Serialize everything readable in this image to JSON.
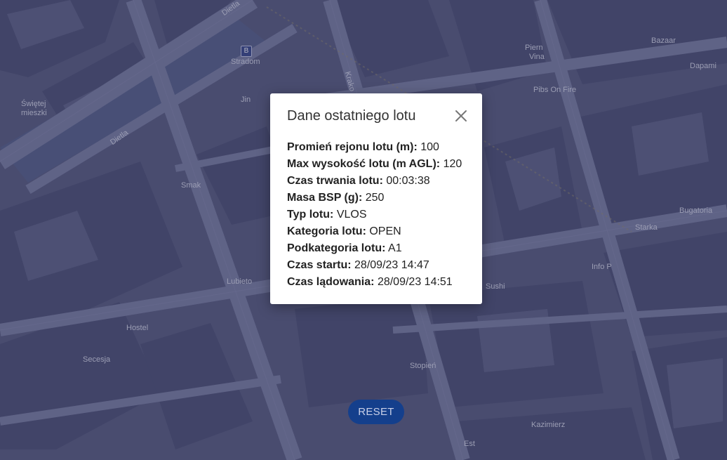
{
  "map": {
    "labels": {
      "dietla1": "Dietla",
      "dietla2": "Dietla",
      "stradom": "Stradom",
      "swietej": "Świętej",
      "mieszki": "mieszki",
      "jin": "Jin",
      "krako": "Krako",
      "smak": "Smak",
      "lubieto": "Lubieto",
      "hostel": "Hostel",
      "secesja": "Secesja",
      "piern": "Piern",
      "vina": "Vina",
      "pibs": "Pibs On Fire",
      "bazaar": "Bazaar",
      "dapami": "Dapami",
      "starka": "Starka",
      "info": "Info P",
      "sushi": "Sushi",
      "galatoria": "Bugatoria",
      "stopien": "Stopień",
      "kazimierz": "Kazimierz",
      "est": "Est"
    },
    "metro_glyph": "B"
  },
  "modal": {
    "title": "Dane ostatniego lotu",
    "close_icon": "close-icon",
    "rows": [
      {
        "label": "Promień rejonu lotu (m):",
        "value": "100"
      },
      {
        "label": "Max wysokość lotu (m AGL):",
        "value": "120"
      },
      {
        "label": "Czas trwania lotu:",
        "value": "00:03:38"
      },
      {
        "label": "Masa BSP (g):",
        "value": "250"
      },
      {
        "label": "Typ lotu:",
        "value": "VLOS"
      },
      {
        "label": "Kategoria lotu:",
        "value": "OPEN"
      },
      {
        "label": "Podkategoria lotu:",
        "value": "A1"
      },
      {
        "label": "Czas startu:",
        "value": "28/09/23 14:47"
      },
      {
        "label": "Czas lądowania:",
        "value": "28/09/23 14:51"
      }
    ]
  },
  "reset_button": {
    "label": "RESET"
  },
  "colors": {
    "map_base": "#5b5e80",
    "road": "#7b7fa0",
    "reset_bg": "#143f8c",
    "modal_bg": "#ffffff"
  }
}
